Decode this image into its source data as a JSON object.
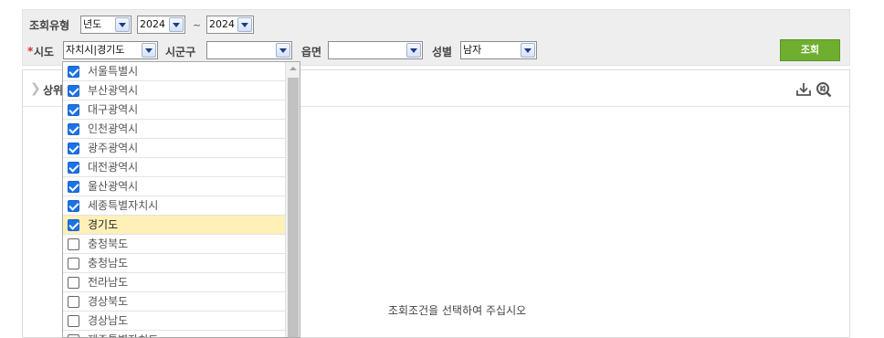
{
  "search": {
    "type_label": "조회유형",
    "type_value": "년도",
    "year_from": "2024",
    "year_sep": "~",
    "year_to": "2024",
    "required_mark": "*",
    "sido_label": "시도",
    "sido_value": "자치시|경기도",
    "sigungu_label": "시군구",
    "sigungu_value": "",
    "eupmyeon_label": "읍면",
    "eupmyeon_value": "",
    "gender_label": "성별",
    "gender_value": "남자",
    "search_button": "조회"
  },
  "result": {
    "title": "상위",
    "empty_message": "조회조건을 선택하여 주십시오",
    "download_icon": "download-icon",
    "zoom_icon": "zoom-reset-icon"
  },
  "sido_options": [
    {
      "label": "서울특별시",
      "checked": true
    },
    {
      "label": "부산광역시",
      "checked": true
    },
    {
      "label": "대구광역시",
      "checked": true
    },
    {
      "label": "인천광역시",
      "checked": true
    },
    {
      "label": "광주광역시",
      "checked": true
    },
    {
      "label": "대전광역시",
      "checked": true
    },
    {
      "label": "울산광역시",
      "checked": true
    },
    {
      "label": "세종특별자치시",
      "checked": true
    },
    {
      "label": "경기도",
      "checked": true
    },
    {
      "label": "충청북도",
      "checked": false
    },
    {
      "label": "충청남도",
      "checked": false
    },
    {
      "label": "전라남도",
      "checked": false
    },
    {
      "label": "경상북도",
      "checked": false
    },
    {
      "label": "경상남도",
      "checked": false
    },
    {
      "label": "제주특별자치도",
      "checked": false
    }
  ],
  "colors": {
    "accent_green": "#6fae2f",
    "checkbox_blue": "#1a73e8",
    "highlight_row": "#fff0b8",
    "required_red": "#d3323c"
  }
}
